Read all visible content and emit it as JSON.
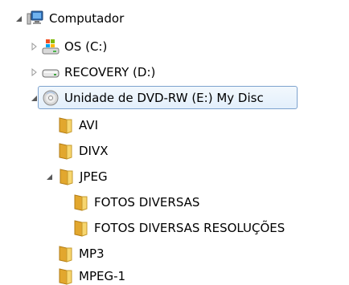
{
  "tree": {
    "computer": {
      "label": "Computador",
      "icon": "computer-icon",
      "expanded": true
    },
    "drives": [
      {
        "label": "OS (C:)",
        "icon": "windows-drive-icon",
        "expanded": false
      },
      {
        "label": "RECOVERY (D:)",
        "icon": "hard-drive-icon",
        "expanded": false
      },
      {
        "label": "Unidade de DVD-RW (E:) My Disc",
        "icon": "dvd-drive-icon",
        "expanded": true,
        "selected": true
      }
    ],
    "dvd_children": [
      {
        "label": "AVI",
        "icon": "folder-icon"
      },
      {
        "label": "DIVX",
        "icon": "folder-icon"
      },
      {
        "label": "JPEG",
        "icon": "folder-icon",
        "expanded": true
      },
      {
        "label": "MP3",
        "icon": "folder-icon"
      },
      {
        "label": "MPEG-1",
        "icon": "folder-icon"
      }
    ],
    "jpeg_children": [
      {
        "label": "FOTOS DIVERSAS",
        "icon": "folder-icon"
      },
      {
        "label": "FOTOS DIVERSAS RESOLUÇÕES",
        "icon": "folder-icon"
      }
    ]
  },
  "colors": {
    "selection_border": "#7da2ce",
    "selection_bg": "#e3effb",
    "folder": "#f1c34e",
    "arrow": "#595959"
  }
}
